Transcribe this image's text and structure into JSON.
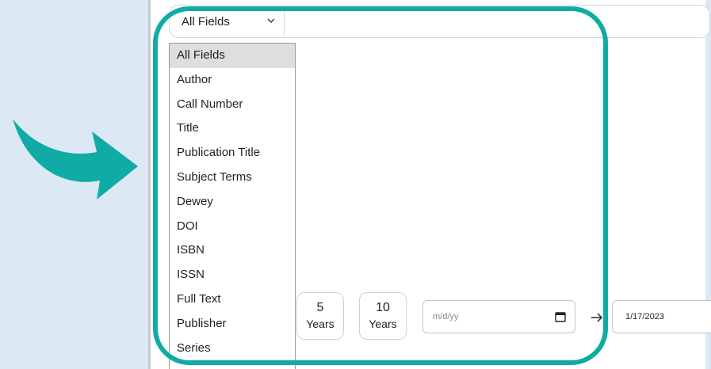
{
  "search": {
    "field_select_value": "All Fields",
    "chevron_icon": "chevron-down-icon"
  },
  "dropdown": {
    "options": [
      "All Fields",
      "Author",
      "Call Number",
      "Title",
      "Publication Title",
      "Subject Terms",
      "Dewey",
      "DOI",
      "ISBN",
      "ISSN",
      "Full Text",
      "Publisher",
      "Series"
    ],
    "selected": "All Fields"
  },
  "date_range": {
    "five_years_num": "5",
    "five_years_label": "Years",
    "ten_years_num": "10",
    "ten_years_label": "Years",
    "from_placeholder": "m/d/yy",
    "to_value": "1/17/2023",
    "separator_icon": "arrow-right-icon",
    "calendar_icon": "calendar-icon"
  },
  "annotation": {
    "pointer_icon": "curved-arrow-icon",
    "highlight_color": "#11aba5",
    "panel_color": "#dce9f5"
  }
}
